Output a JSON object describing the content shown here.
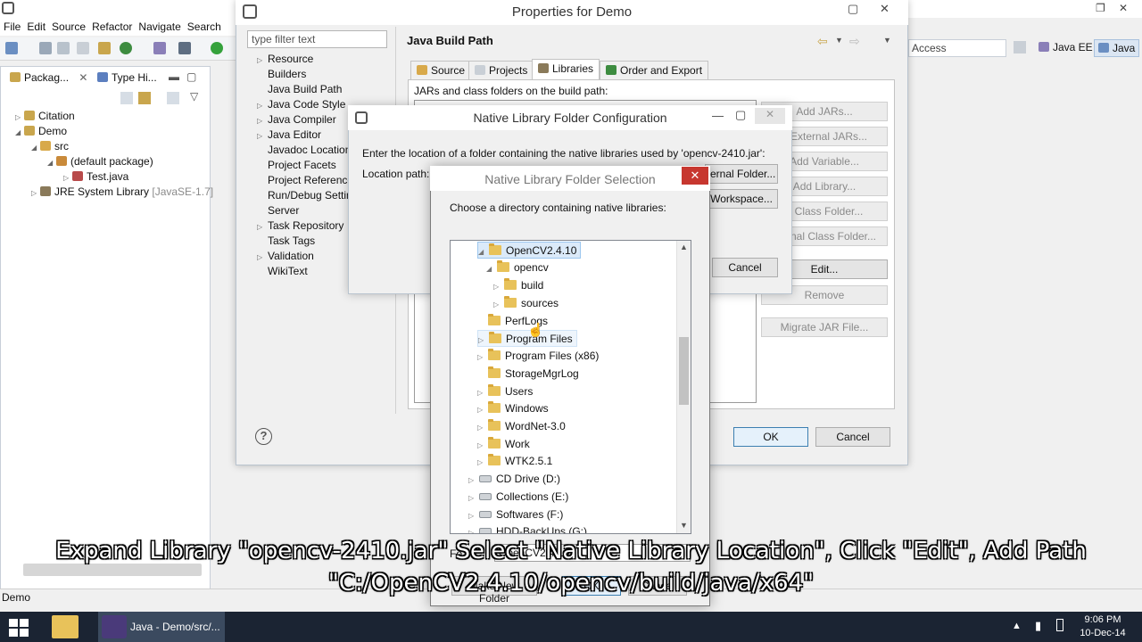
{
  "eclipse": {
    "menu": [
      "File",
      "Edit",
      "Source",
      "Refactor",
      "Navigate",
      "Search"
    ],
    "tabs": {
      "package_explorer": "Packag...",
      "type_hierarchy": "Type Hi..."
    },
    "tree": [
      {
        "label": "Citation",
        "depth": 0
      },
      {
        "label": "Demo",
        "depth": 0
      },
      {
        "label": "src",
        "depth": 1
      },
      {
        "label": "(default package)",
        "depth": 2
      },
      {
        "label": "Test.java",
        "depth": 3
      },
      {
        "label": "JRE System Library",
        "suffix": "[JavaSE-1.7]",
        "depth": 1
      }
    ],
    "quick_access": "Access",
    "perspectives": [
      "Java EE",
      "Java"
    ],
    "status": "Demo"
  },
  "properties": {
    "title": "Properties for Demo",
    "filter_placeholder": "type filter text",
    "nav": [
      {
        "label": "Resource",
        "expandable": true
      },
      {
        "label": "Builders",
        "expandable": false
      },
      {
        "label": "Java Build Path",
        "expandable": false
      },
      {
        "label": "Java Code Style",
        "expandable": true
      },
      {
        "label": "Java Compiler",
        "expandable": true
      },
      {
        "label": "Java Editor",
        "expandable": true
      },
      {
        "label": "Javadoc Location",
        "expandable": false
      },
      {
        "label": "Project Facets",
        "expandable": false
      },
      {
        "label": "Project References",
        "expandable": false
      },
      {
        "label": "Run/Debug Settin",
        "expandable": false
      },
      {
        "label": "Server",
        "expandable": false
      },
      {
        "label": "Task Repository",
        "expandable": true
      },
      {
        "label": "Task Tags",
        "expandable": false
      },
      {
        "label": "Validation",
        "expandable": true
      },
      {
        "label": "WikiText",
        "expandable": false
      }
    ],
    "section_title": "Java Build Path",
    "tabs": [
      "Source",
      "Projects",
      "Libraries",
      "Order and Export"
    ],
    "jars_label": "JARs and class folders on the build path:",
    "side_buttons": [
      "Add JARs...",
      "d External JARs...",
      "Add Variable...",
      "Add Library...",
      "d Class Folder...",
      "xternal Class Folder...",
      "Edit...",
      "Remove",
      "Migrate JAR File..."
    ],
    "ok": "OK",
    "cancel": "Cancel",
    "help": "?"
  },
  "config": {
    "title": "Native Library Folder Configuration",
    "prompt": "Enter the location of a folder containing the native libraries used by 'opencv-2410.jar':",
    "location_label": "Location path:",
    "external_folder": "ternal Folder...",
    "workspace": "Workspace...",
    "cancel": "Cancel"
  },
  "selection": {
    "title": "Native Library Folder Selection",
    "prompt": "Choose a directory containing native libraries:",
    "close": "✕",
    "folders": [
      {
        "label": "OpenCV2.4.10",
        "depth": 0,
        "state": "open",
        "selected": true,
        "kind": "folder"
      },
      {
        "label": "opencv",
        "depth": 1,
        "state": "open",
        "selected": false,
        "kind": "folder"
      },
      {
        "label": "build",
        "depth": 2,
        "state": "closed",
        "selected": false,
        "kind": "folder"
      },
      {
        "label": "sources",
        "depth": 2,
        "state": "closed",
        "selected": false,
        "kind": "folder"
      },
      {
        "label": "PerfLogs",
        "depth": 0,
        "state": "none",
        "selected": false,
        "kind": "folder"
      },
      {
        "label": "Program Files",
        "depth": 0,
        "state": "closed",
        "selected": false,
        "hover": true,
        "kind": "folder"
      },
      {
        "label": "Program Files (x86)",
        "depth": 0,
        "state": "closed",
        "selected": false,
        "kind": "folder"
      },
      {
        "label": "StorageMgrLog",
        "depth": 0,
        "state": "none",
        "selected": false,
        "kind": "folder"
      },
      {
        "label": "Users",
        "depth": 0,
        "state": "closed",
        "selected": false,
        "kind": "folder"
      },
      {
        "label": "Windows",
        "depth": 0,
        "state": "closed",
        "selected": false,
        "kind": "folder"
      },
      {
        "label": "WordNet-3.0",
        "depth": 0,
        "state": "closed",
        "selected": false,
        "kind": "folder"
      },
      {
        "label": "Work",
        "depth": 0,
        "state": "closed",
        "selected": false,
        "kind": "folder"
      },
      {
        "label": "WTK2.5.1",
        "depth": 0,
        "state": "closed",
        "selected": false,
        "kind": "folder"
      },
      {
        "label": "CD Drive (D:)",
        "depth": -1,
        "state": "closed",
        "selected": false,
        "kind": "drive"
      },
      {
        "label": "Collections (E:)",
        "depth": -1,
        "state": "closed",
        "selected": false,
        "kind": "drive"
      },
      {
        "label": "Softwares (F:)",
        "depth": -1,
        "state": "closed",
        "selected": false,
        "kind": "drive"
      },
      {
        "label": "HDD-BackUps (G:)",
        "depth": -1,
        "state": "closed",
        "selected": false,
        "kind": "drive"
      }
    ],
    "folder_label": "Fo",
    "folder_value": "OpenCV2.4.10",
    "make_new_folder": "Make New Folder",
    "ok": "OK",
    "cancel": "Cancel"
  },
  "caption": {
    "line1": "Expand Library \"opencv-2410.jar\" Select \"Native Library Location\", Click \"Edit\", Add Path",
    "line2": "\"C:/OpenCV2.4.10/opencv/build/java/x64\""
  },
  "taskbar": {
    "task": "Java - Demo/src/...",
    "time": "9:06 PM",
    "date": "10-Dec-14"
  },
  "colors": {
    "selection_bg": "#dbeaf9",
    "close_red": "#c7372f",
    "taskbar": "#1b2433",
    "folder": "#e8c25a"
  }
}
